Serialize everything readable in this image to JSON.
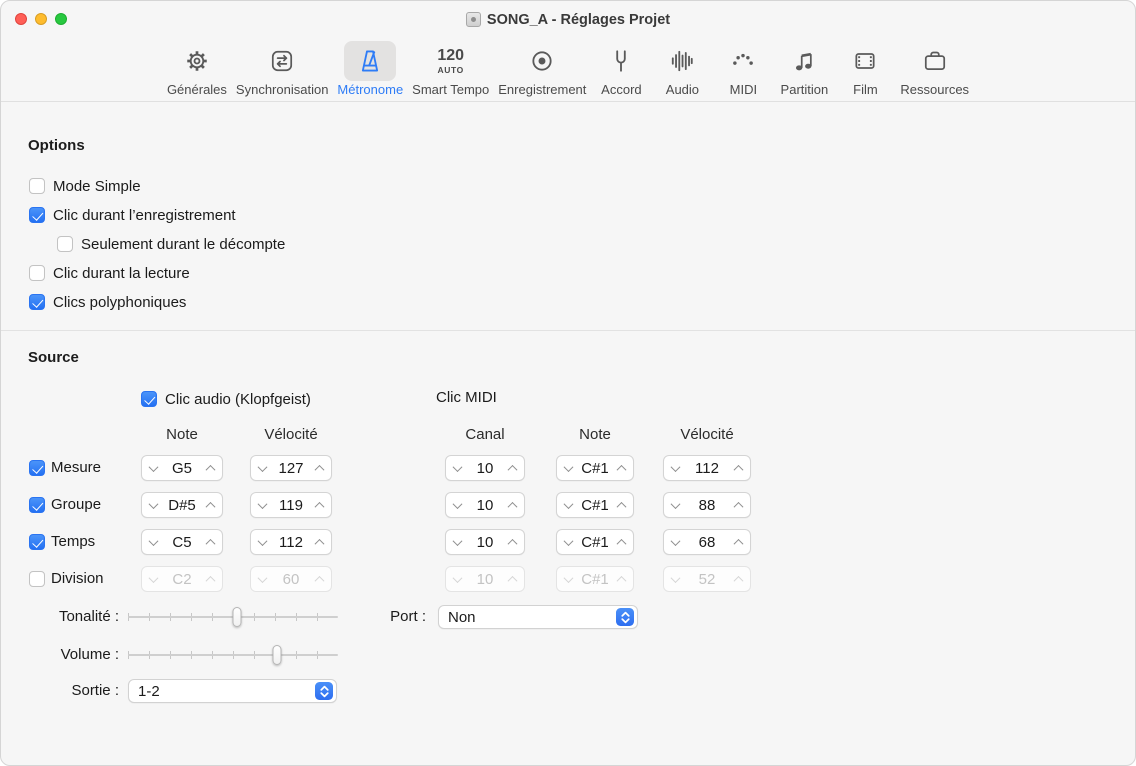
{
  "window": {
    "title": "SONG_A - Réglages Projet"
  },
  "toolbar": {
    "tabs": [
      {
        "label": "Générales"
      },
      {
        "label": "Synchronisation"
      },
      {
        "label": "Métronome"
      },
      {
        "label": "Smart Tempo",
        "tempo_value": "120",
        "tempo_mode": "AUTO"
      },
      {
        "label": "Enregistrement"
      },
      {
        "label": "Accord"
      },
      {
        "label": "Audio"
      },
      {
        "label": "MIDI"
      },
      {
        "label": "Partition"
      },
      {
        "label": "Film"
      },
      {
        "label": "Ressources"
      }
    ]
  },
  "options": {
    "heading": "Options",
    "items": [
      {
        "label": "Mode Simple",
        "checked": false
      },
      {
        "label": "Clic durant l’enregistrement",
        "checked": true
      },
      {
        "label": "Seulement durant le décompte",
        "checked": false
      },
      {
        "label": "Clic durant la lecture",
        "checked": false
      },
      {
        "label": "Clics polyphoniques",
        "checked": true
      }
    ]
  },
  "source": {
    "heading": "Source",
    "audio_click": {
      "label": "Clic audio (Klopfgeist)",
      "checked": true
    },
    "midi_click_label": "Clic MIDI",
    "audio_columns": {
      "note": "Note",
      "velocity": "Vélocité"
    },
    "midi_columns": {
      "channel": "Canal",
      "note": "Note",
      "velocity": "Vélocité"
    },
    "rows": [
      {
        "label": "Mesure",
        "checked": true,
        "audio_note": "G5",
        "audio_velocity": "127",
        "midi_channel": "10",
        "midi_note": "C#1",
        "midi_velocity": "112"
      },
      {
        "label": "Groupe",
        "checked": true,
        "audio_note": "D#5",
        "audio_velocity": "119",
        "midi_channel": "10",
        "midi_note": "C#1",
        "midi_velocity": "88"
      },
      {
        "label": "Temps",
        "checked": true,
        "audio_note": "C5",
        "audio_velocity": "112",
        "midi_channel": "10",
        "midi_note": "C#1",
        "midi_velocity": "68"
      },
      {
        "label": "Division",
        "checked": false,
        "audio_note": "C2",
        "audio_velocity": "60",
        "midi_channel": "10",
        "midi_note": "C#1",
        "midi_velocity": "52"
      }
    ],
    "tonality_label": "Tonalité :",
    "volume_label": "Volume :",
    "output_label": "Sortie :",
    "output_value": "1-2",
    "port_label": "Port :",
    "port_value": "Non"
  }
}
